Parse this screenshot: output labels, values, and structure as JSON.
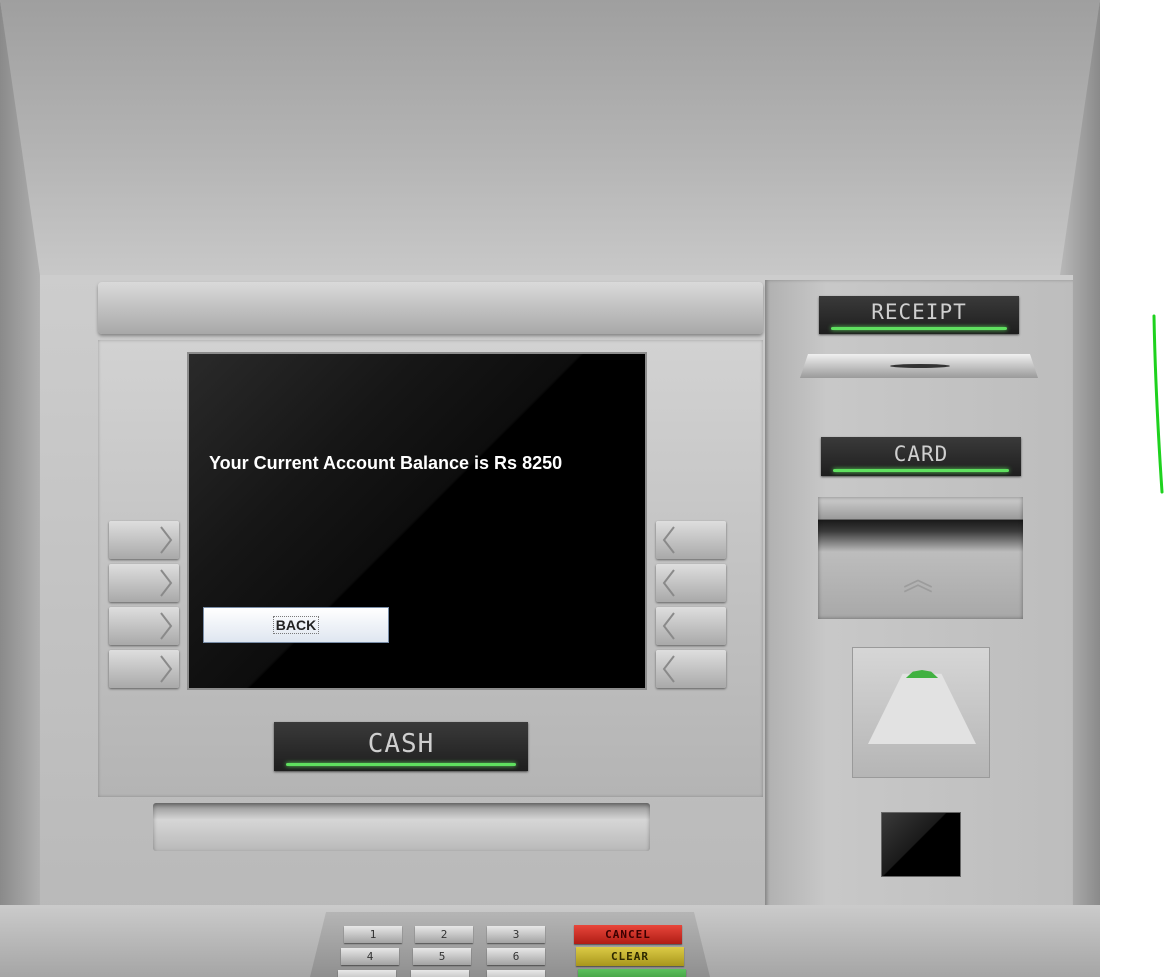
{
  "screen": {
    "message": "Your Current Account Balance is Rs 8250",
    "back_label": "BACK"
  },
  "labels": {
    "cash": "CASH",
    "receipt": "RECEIPT",
    "card": "CARD"
  },
  "keypad": {
    "keys": [
      "1",
      "2",
      "3",
      "4",
      "5",
      "6"
    ],
    "cancel": "CANCEL",
    "clear": "CLEAR"
  },
  "colors": {
    "indicator_green": "#5fe05f",
    "cancel_red": "#d0271e",
    "clear_yellow": "#c9b52a",
    "enter_green": "#3ea33e"
  }
}
